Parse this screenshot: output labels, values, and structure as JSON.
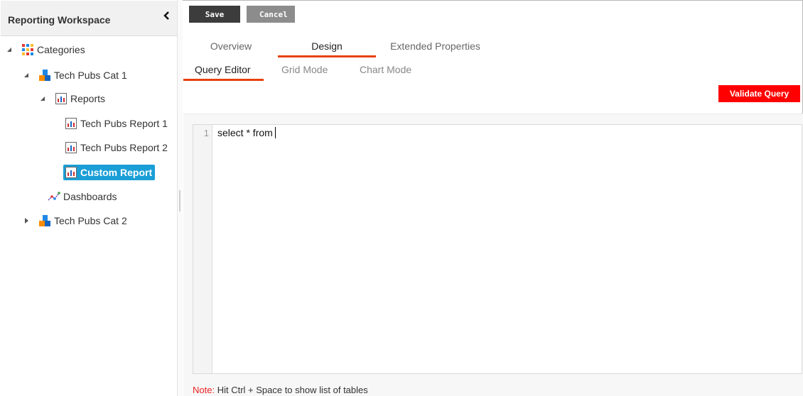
{
  "sidebar": {
    "title": "Reporting Workspace",
    "tree": {
      "root": "Categories",
      "cat1": "Tech Pubs Cat 1",
      "reports": "Reports",
      "report1": "Tech Pubs Report 1",
      "report2": "Tech Pubs Report 2",
      "custom": "Custom Report",
      "dashboards": "Dashboards",
      "cat2": "Tech Pubs Cat 2"
    }
  },
  "toolbar": {
    "save_label": "Save",
    "cancel_label": "Cancel"
  },
  "tabs": [
    {
      "label": "Overview",
      "active": false
    },
    {
      "label": "Design",
      "active": true
    },
    {
      "label": "Extended Properties",
      "active": false
    }
  ],
  "subtabs": [
    {
      "label": "Query Editor",
      "active": true
    },
    {
      "label": "Grid Mode",
      "active": false
    },
    {
      "label": "Chart Mode",
      "active": false
    }
  ],
  "validate_label": "Validate Query",
  "editor": {
    "line_number": "1",
    "code": "select * from"
  },
  "note": {
    "label": "Note:",
    "text": " Hit Ctrl + Space to show list of tables"
  },
  "colors": {
    "accent_orange": "#e8410a",
    "selected_blue": "#1a9ed6",
    "validate_red": "#ff0000"
  }
}
